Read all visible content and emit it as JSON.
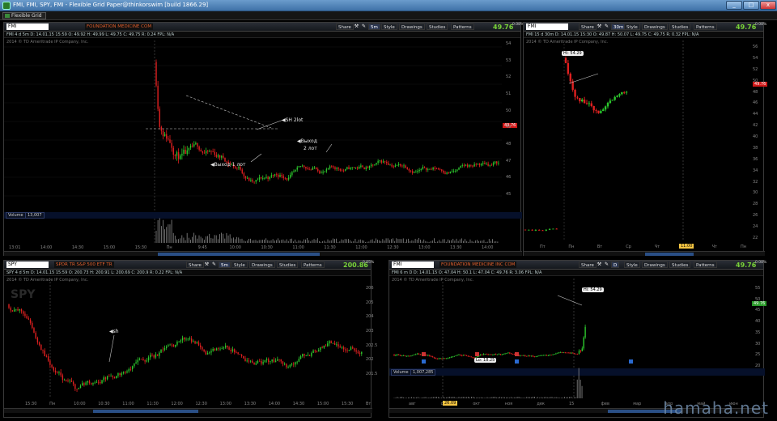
{
  "window": {
    "title": "FMI, FMI, SPY, FMI - Flexible Grid Paper@thinkorswim [build 1866.29]",
    "minimize": "_",
    "maximize": "□",
    "close": "x"
  },
  "menubar": {
    "label": "Flexible Grid"
  },
  "toolbar_labels": {
    "share": "Share",
    "style": "Style",
    "drawings": "Drawings",
    "studies": "Studies",
    "patterns": "Patterns"
  },
  "watermark": "hamaha.net",
  "panels": {
    "p1": {
      "symbol": "FMI",
      "company": "FOUNDATION MEDICINE COM",
      "interval": "5m",
      "last": "49.76",
      "pct": "0.08%",
      "info": "FMI 4 d 5m  D: 14.01.15 15:59  O: 49.92  H: 49.99  L: 49.75  C: 49.75  R: 0.24  FPL: N/A",
      "sub": "2014 © TD Ameritrade IP Company, Inc.",
      "price_tag": "49.76",
      "volume_label": "Volume",
      "volume_value": "13,007",
      "notes": [
        {
          "text": "◀SH 2lot"
        },
        {
          "text": "◀Выход"
        },
        {
          "text": "2 лот"
        },
        {
          "text": "◀Выход 1 лот"
        }
      ],
      "yaxis": [
        "54",
        "53",
        "52",
        "51",
        "50",
        "49",
        "48",
        "47",
        "46",
        "45"
      ],
      "xaxis": [
        "13:01",
        "14:00",
        "14:30",
        "15:00",
        "15:30",
        "Пн",
        "9:45",
        "10:00",
        "10:30",
        "11:00",
        "11:30",
        "12:00",
        "12:30",
        "13:00",
        "13:30",
        "14:00"
      ]
    },
    "p2": {
      "symbol": "FMI",
      "interval": "30m",
      "last": "49.76",
      "pct": "0.08%",
      "info": "FMI 15 d 30m  D: 14.01.15 15:30  O: 49.87  H: 50.07  L: 49.75  C: 49.75  R: 0.32  FPL: N/A",
      "sub": "2014 © TD Ameritrade IP Company, Inc.",
      "price_tag": "49.76",
      "note": "Hi: 54.29",
      "timebox": "11:00",
      "yaxis": [
        "56",
        "54",
        "52",
        "50",
        "48",
        "46",
        "44",
        "42",
        "40",
        "38",
        "36",
        "34",
        "32",
        "30",
        "28",
        "26",
        "24",
        "22"
      ],
      "xaxis": [
        "Пт",
        "Пн",
        "Вт",
        "Ср",
        "Чт",
        "Пн",
        "Чт",
        "Пн"
      ]
    },
    "p3": {
      "symbol": "SPY",
      "company": "SPDR TR S&P 500 ETF TR",
      "interval": "5m",
      "last": "200.86",
      "pct": "0.05%",
      "info": "SPY 4 d 5m  D: 14.01.15 15:59  O: 200.73  H: 200.91  L: 200.69  C: 200.9  R: 0.22  FPL: N/A",
      "sub": "2014 © TD Ameritrade IP Company, Inc.",
      "watermark_sym": "SPY",
      "note": "◀sh",
      "yaxis": [
        "206",
        "205",
        "204",
        "203",
        "202.5",
        "202",
        "201.5"
      ],
      "xaxis": [
        "15:30",
        "Пн",
        "10:00",
        "10:30",
        "11:00",
        "11:30",
        "12:00",
        "12:30",
        "13:00",
        "13:30",
        "14:00",
        "14:30",
        "15:00",
        "15:30",
        "Вт"
      ]
    },
    "p4": {
      "symbol": "FMI",
      "company": "FOUNDATION MEDICINE INC COM",
      "interval": "D",
      "last": "49.76",
      "pct": "0.08%",
      "info": "FMI 6 m D  D: 14.01.15  O: 47.04  H: 50.1  L: 47.04  C: 49.76  R: 3.06  FPL: N/A",
      "sub": "2014 © TD Ameritrade IP Company, Inc.",
      "price_tag": "49.76",
      "note": "Hi: 54.29",
      "lo_note": "Lo: 18.25",
      "volume_label": "Volume",
      "volume_value": "1,007,285",
      "timebox": "26.09",
      "yaxis": [
        "55",
        "50",
        "45",
        "40",
        "35",
        "30",
        "25",
        "20"
      ],
      "xaxis": [
        "авг",
        "сен",
        "окт",
        "ноя",
        "дек",
        "15",
        "фев",
        "мар",
        "апр",
        "май",
        "июн"
      ]
    }
  }
}
